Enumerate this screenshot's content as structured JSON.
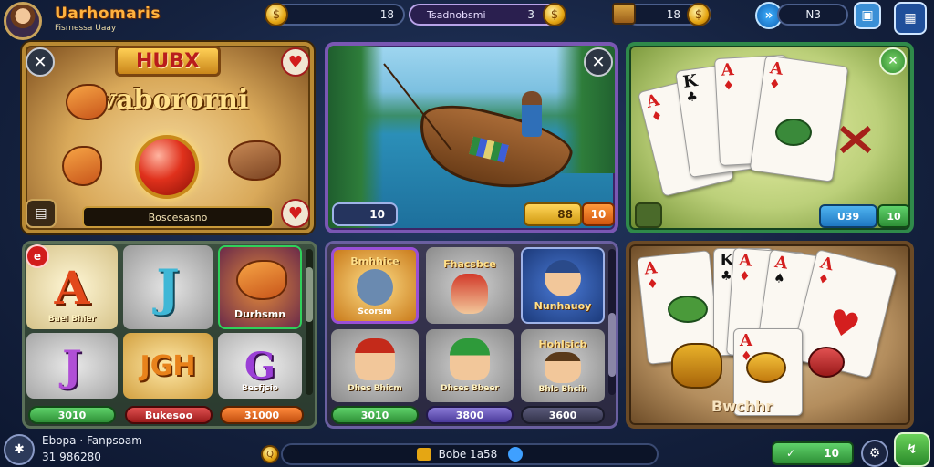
{
  "header": {
    "game_title": "Uarhomaris",
    "game_subtitle": "Fisrnessa Uaay",
    "coins_value": "18",
    "event_label": "Tsadnobsmi",
    "event_value": "3",
    "gems_value": "18",
    "level_value": "N3"
  },
  "panel_fishing": {
    "badge": "HUBX",
    "title": "Ivabororni",
    "name_field": "Boscesasno"
  },
  "panel_boat": {
    "left_value": "10",
    "gold_value": "88",
    "button_label": "10"
  },
  "panel_cards_top": {
    "value": "U39",
    "button_label": "10"
  },
  "panel_letters": {
    "tile_a_label": "Bael Bhier",
    "tile_fish_label": "Durhsmn",
    "tile_g_label": "Besfjsio",
    "tile_jgh": "JGH",
    "bar_1": "3010",
    "bar_2": "Bukesoo",
    "bar_3": "31000"
  },
  "panel_characters": {
    "char_1_title": "Bmhhice",
    "char_1_sub": "Scorsm",
    "char_2_title": "Fhacsbce",
    "char_3_title": "Nunhauoy",
    "char_4_label": "Dhes Bhicm",
    "char_5_label": "Dhses Bbeer",
    "char_6_title": "Hohlsicb",
    "char_6_label": "Bhls Bhcih",
    "bar_1": "3010",
    "bar_2": "3800",
    "bar_3": "3600"
  },
  "panel_cards_bottom": {
    "footer_text": "Bwchhr"
  },
  "footer": {
    "player_name": "Ebopa · Fanpsoam",
    "player_score": "31 986280",
    "center_text": "Bobe 1a58",
    "confirm_value": "10"
  },
  "colors": {
    "accent_gold": "#e5a613",
    "accent_green": "#3aa33e",
    "accent_purple": "#7a57b3",
    "accent_red": "#d21c1c"
  },
  "icons": [
    "coin-icon",
    "treasure-icon",
    "gem-icon",
    "settings-icon",
    "close-icon",
    "heart-icon",
    "check-icon",
    "gear-icon",
    "grid-icon"
  ]
}
